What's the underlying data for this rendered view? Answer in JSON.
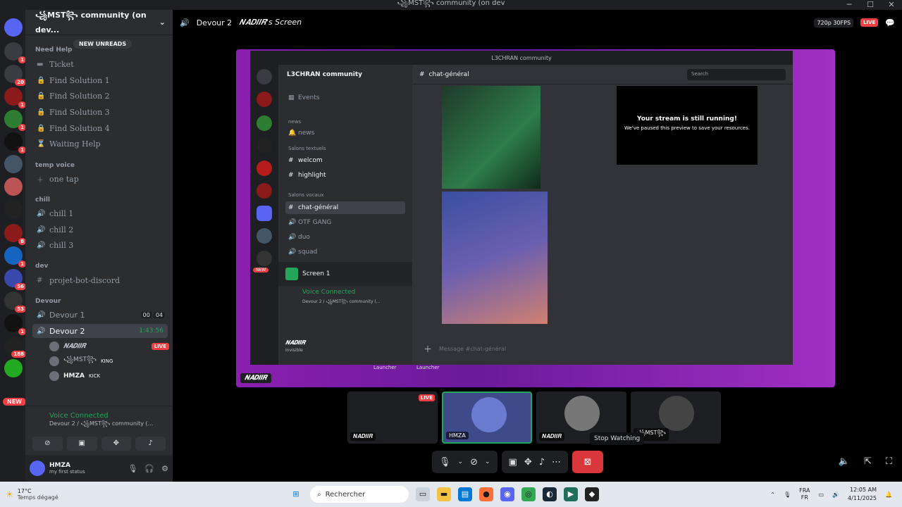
{
  "window": {
    "title": "꧁MST꧂ community (on dev"
  },
  "servers": {
    "new_label": "NEW"
  },
  "guild": {
    "name": "꧁MST꧂ community (on dev...",
    "new_unreads": "NEW UNREADS",
    "categories": {
      "need_help": "Need Help",
      "temp_voice": "temp voice",
      "chill": "chill",
      "dev": "dev",
      "devour": "Devour"
    },
    "channels": {
      "ticket": "Ticket",
      "find1": "Find Solution 1",
      "find2": "Find Solution 2",
      "find3": "Find Solution 3",
      "find4": "Find Solution 4",
      "waiting": "Waiting Help",
      "one_tap": "one tap",
      "chill1": "chill 1",
      "chill2": "chill 2",
      "chill3": "chill 3",
      "projet": "projet-bot-discord",
      "devour1": "Devour 1",
      "devour1_a": "00",
      "devour1_b": "04",
      "devour2": "Devour 2",
      "devour2_time": "1:43:56"
    },
    "voice_users": [
      {
        "name": "𝑵𝑨𝑫𝑰𝑰𝑹",
        "badge": "LIVE"
      },
      {
        "name": "꧁MST꧂",
        "role": "KING"
      },
      {
        "name": "HMZA",
        "role": "KICK"
      }
    ]
  },
  "voice": {
    "status": "Voice Connected",
    "location": "Devour 2 / ꧁MST꧂ community (..."
  },
  "user": {
    "name": "HMZA",
    "status": "my first status"
  },
  "stage": {
    "channel": "Devour 2",
    "stream_owner": "𝑵𝑨𝑫𝑰𝑰𝑹's Screen",
    "quality": "720p 30FPS",
    "live": "LIVE",
    "streamer_tag": "𝑵𝑨𝑫𝑰𝑰𝑹"
  },
  "inner": {
    "title": "L3CHRAN community",
    "guild": "L3CHRAN community",
    "channel": "chat-général",
    "search": "Search",
    "events": "Events",
    "cat_news": "news",
    "news": "news",
    "cat_text": "Salons textuels",
    "welcom": "welcom",
    "highlight": "highlight",
    "cat_voice": "Salons vocaux",
    "chat": "chat-général",
    "otf": "OTF GANG",
    "duo": "duo",
    "squad": "squad",
    "screen": "Screen 1",
    "vc": "Voice Connected",
    "vc_loc": "Devour 2 / ꧁MST꧂ community (...",
    "user": "𝑵𝑨𝑫𝑰𝑰𝑹",
    "user_status": "Invisible",
    "message_placeholder": "Message #chat-général",
    "launcher": "Launcher",
    "overlay_title": "Your stream is still running!",
    "overlay_sub": "We've paused this preview to save your resources.",
    "new": "NEW"
  },
  "tiles": [
    {
      "name": "𝑵𝑨𝑫𝑰𝑰𝑹",
      "live": "LIVE"
    },
    {
      "name": "HMZA"
    },
    {
      "name": "𝑵𝑨𝑫𝑰𝑰𝑹"
    },
    {
      "name": "꧁MST꧂"
    }
  ],
  "tooltip": "Stop Watching",
  "taskbar": {
    "temp": "17°C",
    "weather": "Temps dégagé",
    "search": "Rechercher",
    "lang": "FRA",
    "lang2": "FR",
    "time": "12:05 AM",
    "date": "4/11/2025"
  }
}
